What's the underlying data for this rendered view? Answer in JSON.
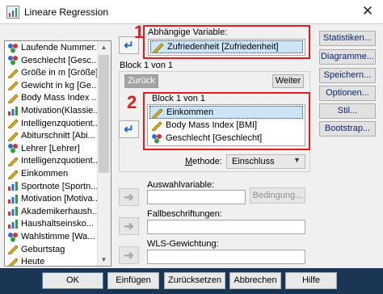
{
  "window": {
    "title": "Lineare Regression",
    "close_glyph": "✕"
  },
  "variables": {
    "items": [
      {
        "label": "Laufende Nummer...",
        "icon": "nominal-icon"
      },
      {
        "label": "Geschlecht [Gesc...",
        "icon": "nominal-icon"
      },
      {
        "label": "Größe in m [Größe]",
        "icon": "scale-icon"
      },
      {
        "label": "Gewicht in kg [Ge...",
        "icon": "scale-icon"
      },
      {
        "label": "Body Mass Index ...",
        "icon": "scale-icon"
      },
      {
        "label": "Motivation(Klassie...",
        "icon": "ordinal-icon"
      },
      {
        "label": "Intelligenzquotient...",
        "icon": "scale-icon"
      },
      {
        "label": "Abiturschnitt [Abi...",
        "icon": "scale-icon"
      },
      {
        "label": "Lehrer [Lehrer]",
        "icon": "nominal-icon"
      },
      {
        "label": "Intelligenzquotient...",
        "icon": "scale-icon"
      },
      {
        "label": "Einkommen",
        "icon": "scale-icon"
      },
      {
        "label": "Sportnote [Sportn...",
        "icon": "ordinal-icon"
      },
      {
        "label": "Motivation [Motiva...",
        "icon": "ordinal-icon"
      },
      {
        "label": "Akademikerhaush...",
        "icon": "ordinal-icon"
      },
      {
        "label": "Haushaltseinsko...",
        "icon": "ordinal-icon"
      },
      {
        "label": "Wahlstimme [Wa...",
        "icon": "nominal-icon"
      },
      {
        "label": "Geburtstag",
        "icon": "scale-icon"
      },
      {
        "label": "Heute",
        "icon": "scale-icon"
      }
    ]
  },
  "dependent": {
    "label": "Abhängige Variable:",
    "value": "Zufriedenheit [Zufriedenheit]",
    "marker": "1"
  },
  "block": {
    "header": "Block 1 von 1",
    "inner_header": "Block 1 von 1",
    "back_label": "Zurück",
    "next_label": "Weiter",
    "marker": "2",
    "independents": [
      {
        "label": "Einkommen",
        "icon": "scale-icon",
        "selected": true
      },
      {
        "label": "Body Mass Index [BMI]",
        "icon": "scale-icon",
        "selected": false
      },
      {
        "label": "Geschlecht [Geschlecht]",
        "icon": "nominal-icon",
        "selected": false
      }
    ]
  },
  "method": {
    "label": "Methode:",
    "value": "Einschluss"
  },
  "selection": {
    "label": "Auswahlvariable:",
    "condition_button": "Bedingung..."
  },
  "case_labels": {
    "label": "Fallbeschriftungen:"
  },
  "wls": {
    "label": "WLS-Gewichtung:"
  },
  "side_buttons": [
    "Statistiken...",
    "Diagramme...",
    "Speichern...",
    "Optionen...",
    "Stil...",
    "Bootstrap..."
  ],
  "bottom_buttons": {
    "ok": "OK",
    "paste": "Einfügen",
    "reset": "Zurücksetzen",
    "cancel": "Abbrechen",
    "help": "Hilfe"
  },
  "colors": {
    "highlight": "#e41b23",
    "bottom_bar": "#1b3654",
    "arrow_blue": "#1f62c8"
  }
}
